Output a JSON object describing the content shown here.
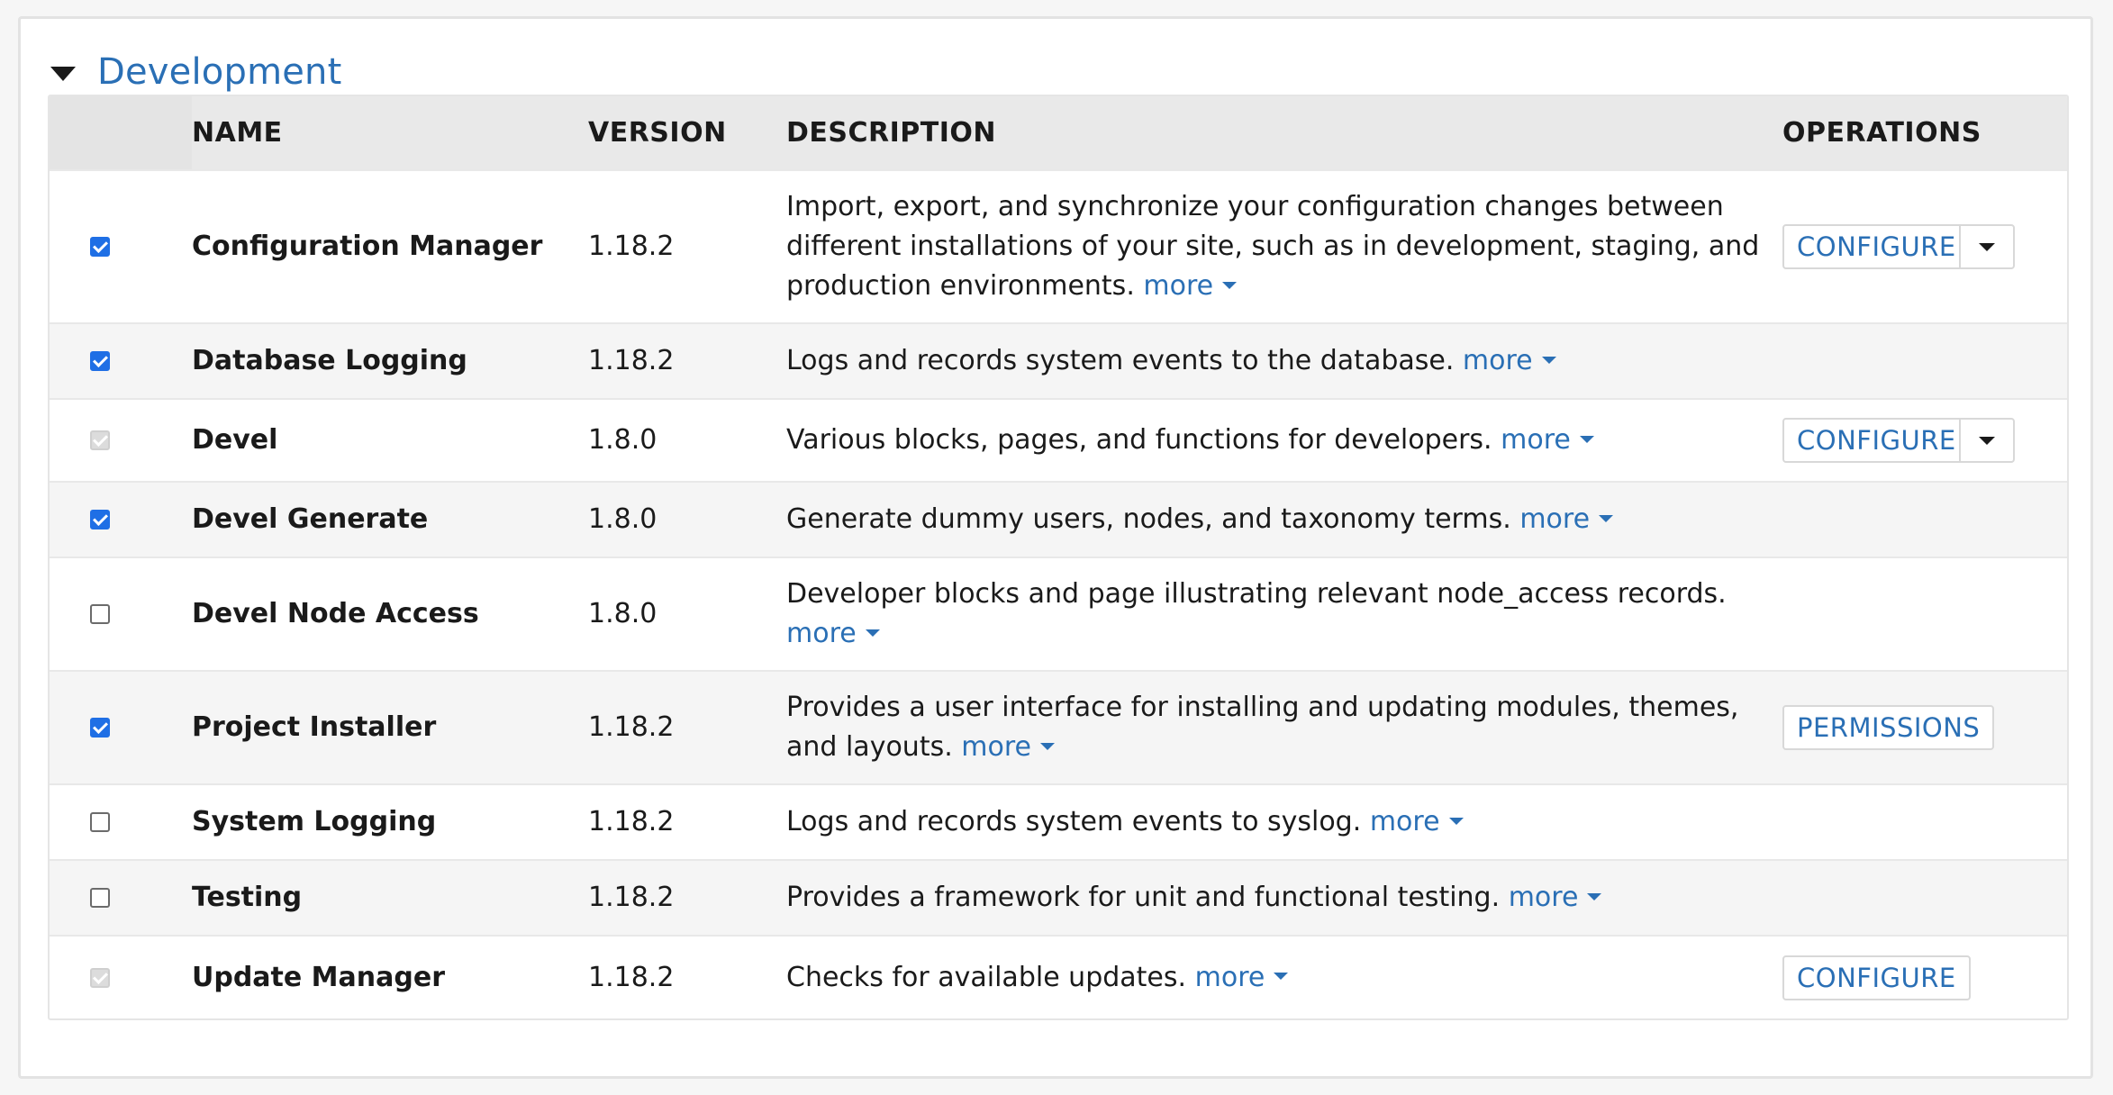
{
  "section": {
    "title": "Development"
  },
  "table": {
    "headers": {
      "name": "NAME",
      "version": "VERSION",
      "description": "DESCRIPTION",
      "operations": "OPERATIONS"
    },
    "rows": [
      {
        "checkbox": "checked",
        "name": "Configuration Manager",
        "version": "1.18.2",
        "description": "Import, export, and synchronize your configuration changes between different installations of your site, such as in development, staging, and production environments.",
        "more": "more",
        "operation": "CONFIGURE",
        "operation_has_dropdown": true
      },
      {
        "checkbox": "checked",
        "name": "Database Logging",
        "version": "1.18.2",
        "description": "Logs and records system events to the database.",
        "more": "more",
        "operation": "",
        "operation_has_dropdown": false
      },
      {
        "checkbox": "disabled",
        "name": "Devel",
        "version": "1.8.0",
        "description": "Various blocks, pages, and functions for developers.",
        "more": "more",
        "operation": "CONFIGURE",
        "operation_has_dropdown": true
      },
      {
        "checkbox": "checked",
        "name": "Devel Generate",
        "version": "1.8.0",
        "description": "Generate dummy users, nodes, and taxonomy terms.",
        "more": "more",
        "operation": "",
        "operation_has_dropdown": false
      },
      {
        "checkbox": "unchecked",
        "name": "Devel Node Access",
        "version": "1.8.0",
        "description": "Developer blocks and page illustrating relevant node_access records.",
        "more": "more",
        "operation": "",
        "operation_has_dropdown": false
      },
      {
        "checkbox": "checked",
        "name": "Project Installer",
        "version": "1.18.2",
        "description": "Provides a user interface for installing and updating modules, themes, and layouts.",
        "more": "more",
        "operation": "PERMISSIONS",
        "operation_has_dropdown": false
      },
      {
        "checkbox": "unchecked",
        "name": "System Logging",
        "version": "1.18.2",
        "description": "Logs and records system events to syslog.",
        "more": "more",
        "operation": "",
        "operation_has_dropdown": false
      },
      {
        "checkbox": "unchecked",
        "name": "Testing",
        "version": "1.18.2",
        "description": "Provides a framework for unit and functional testing.",
        "more": "more",
        "operation": "",
        "operation_has_dropdown": false
      },
      {
        "checkbox": "disabled",
        "name": "Update Manager",
        "version": "1.18.2",
        "description": "Checks for available updates.",
        "more": "more",
        "operation": "CONFIGURE",
        "operation_has_dropdown": false
      }
    ]
  },
  "colors": {
    "link": "#2a6fb5",
    "checkbox_checked": "#1f6fe5",
    "header_bg": "#e9e9e9",
    "alt_row_bg": "#f5f5f5"
  }
}
